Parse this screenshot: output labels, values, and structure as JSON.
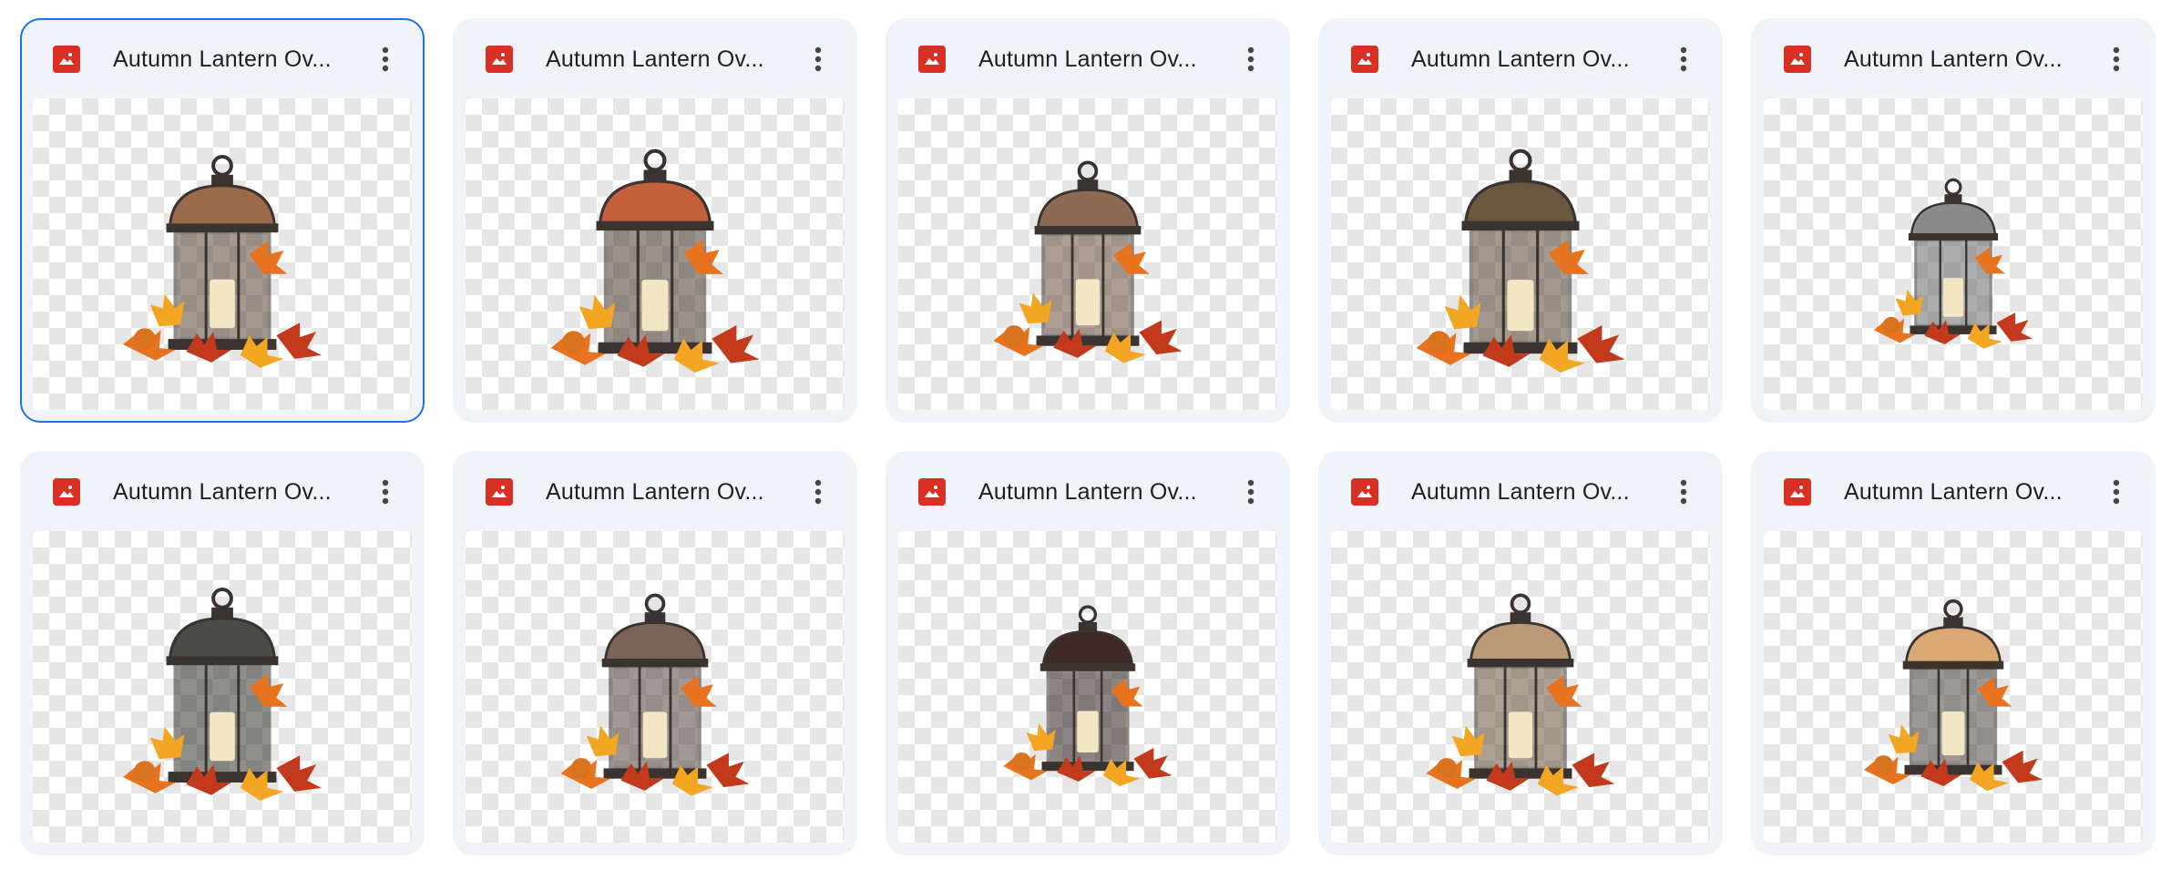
{
  "files": [
    {
      "name": "Autumn Lantern Ov...",
      "selected": true,
      "icon": "image-file-icon",
      "cap": "#9a6a4a",
      "glass": "#5a4535"
    },
    {
      "name": "Autumn Lantern Ov...",
      "selected": false,
      "icon": "image-file-icon",
      "cap": "#c4603b",
      "glass": "#4a3a30"
    },
    {
      "name": "Autumn Lantern Ov...",
      "selected": false,
      "icon": "image-file-icon",
      "cap": "#8d6a52",
      "glass": "#6a5040"
    },
    {
      "name": "Autumn Lantern Ov...",
      "selected": false,
      "icon": "image-file-icon",
      "cap": "#6b5640",
      "glass": "#5a4535"
    },
    {
      "name": "Autumn Lantern Ov...",
      "selected": false,
      "icon": "image-file-icon",
      "cap": "#8a8a8a",
      "glass": "#6b6b6b"
    },
    {
      "name": "Autumn Lantern Ov...",
      "selected": false,
      "icon": "image-file-icon",
      "cap": "#4b4b48",
      "glass": "#333330"
    },
    {
      "name": "Autumn Lantern Ov...",
      "selected": false,
      "icon": "image-file-icon",
      "cap": "#7a6359",
      "glass": "#55443c"
    },
    {
      "name": "Autumn Lantern Ov...",
      "selected": false,
      "icon": "image-file-icon",
      "cap": "#3e2a25",
      "glass": "#2f211d"
    },
    {
      "name": "Autumn Lantern Ov...",
      "selected": false,
      "icon": "image-file-icon",
      "cap": "#b89a78",
      "glass": "#6b5340"
    },
    {
      "name": "Autumn Lantern Ov...",
      "selected": false,
      "icon": "image-file-icon",
      "cap": "#d9a873",
      "glass": "#4a4540"
    }
  ],
  "colors": {
    "accent": "#1a73e8",
    "card_bg": "#f0f4f9",
    "file_icon": "#d93025",
    "leaf_orange": "#e8731e",
    "leaf_red": "#c2391b",
    "leaf_yellow": "#f2a623",
    "candle": "#f3e6c4"
  }
}
